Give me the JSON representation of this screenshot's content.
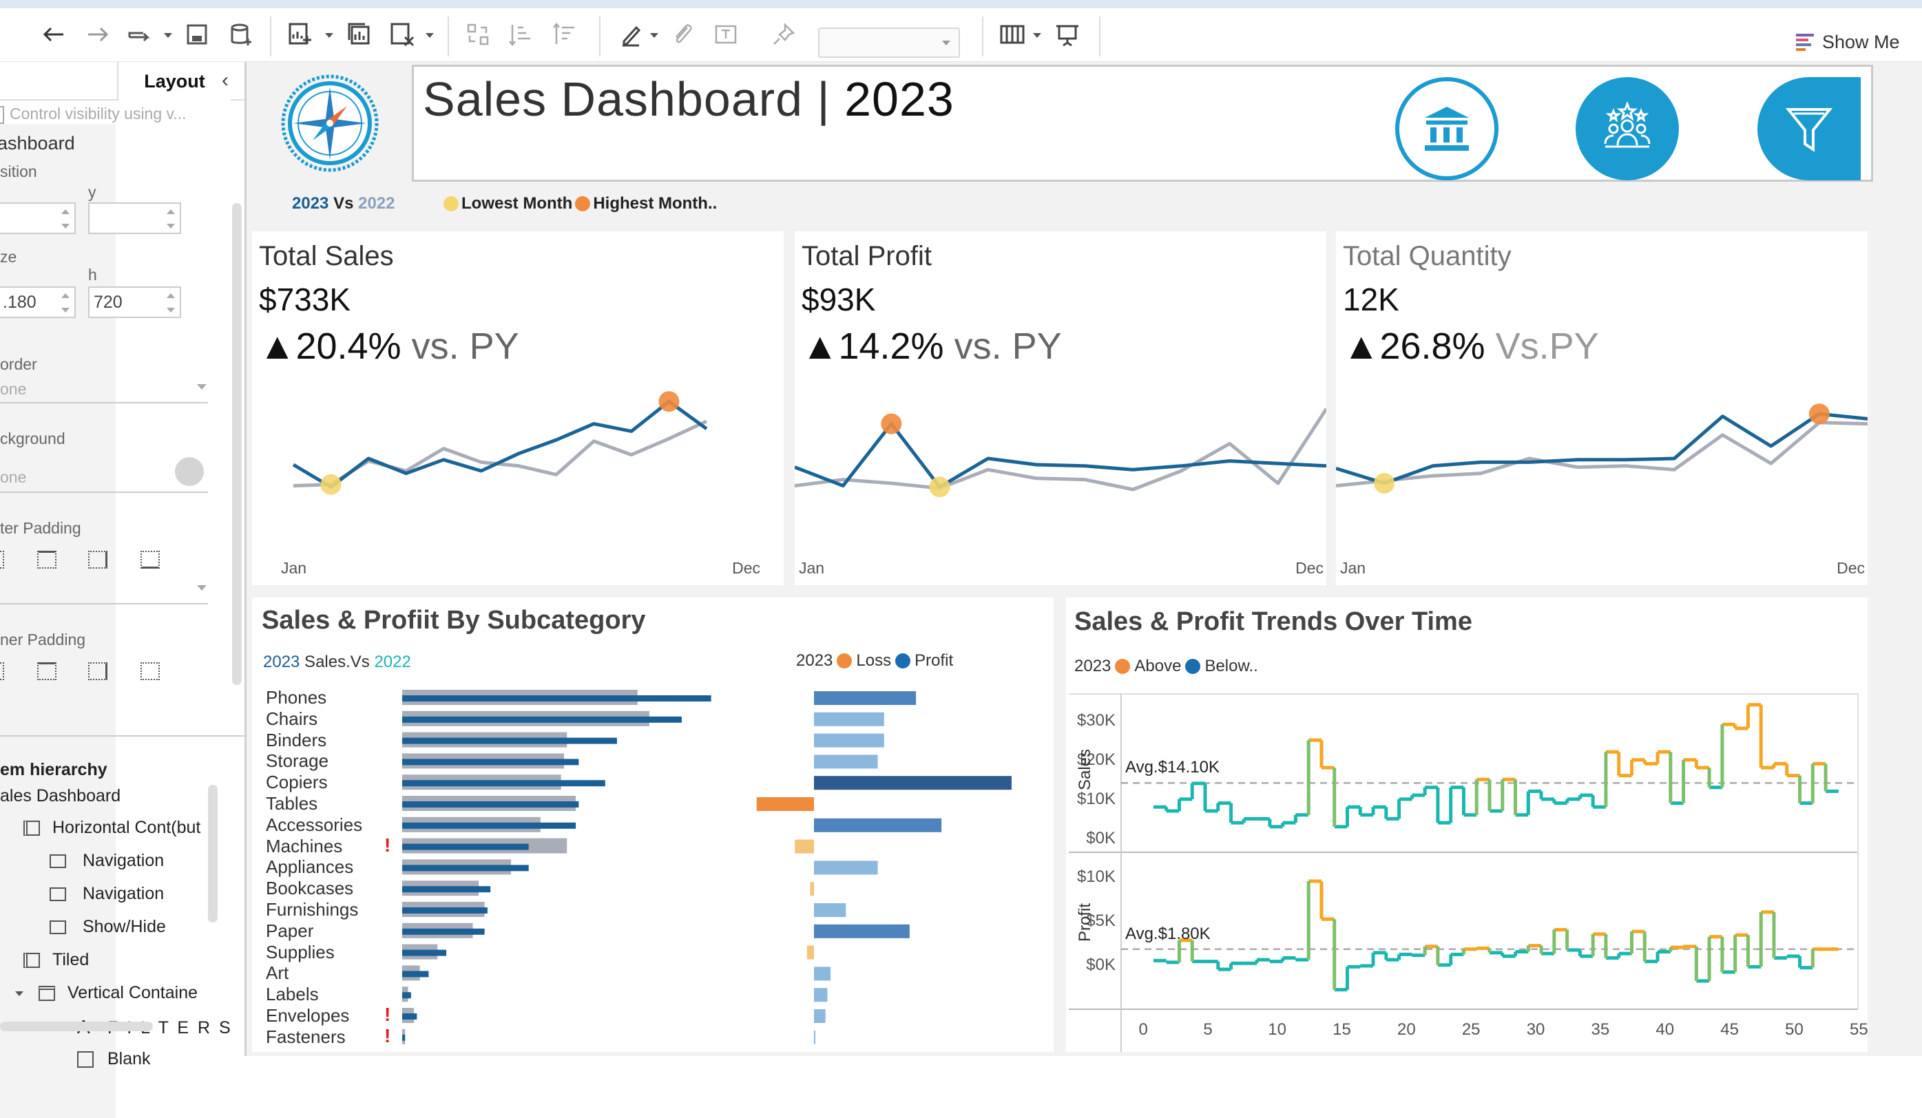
{
  "toolbar": {
    "show_me_label": "Show Me",
    "icons": [
      "undo-icon",
      "redo-icon",
      "replay-icon",
      "save-icon",
      "add-datasource-icon",
      "new-sheet-icon",
      "duplicate-sheet-icon",
      "clear-sheet-icon",
      "swap-icon",
      "sort-asc-icon",
      "sort-desc-icon",
      "highlight-icon",
      "attach-icon",
      "label-icon",
      "pin-icon",
      "fit-select",
      "show-cards-icon",
      "presentation-icon"
    ]
  },
  "left_pane": {
    "tab_dashboard": "ashboard",
    "tab_layout": "Layout",
    "control_visibility": "Control visibility using v...",
    "position_label": "sition",
    "y_label": "y",
    "size_label": "ze",
    "h_label": "h",
    "w_value": ".180",
    "h_value": "720",
    "border_label": "order",
    "border_value": "one",
    "background_label": "ckground",
    "background_value": "one",
    "outer_padding_label": "ter Padding",
    "inner_padding_label": "ner Padding",
    "hierarchy_title": "em hierarchy",
    "hierarchy_root": "ales Dashboard",
    "hierarchy_items": [
      {
        "label": "Horizontal Cont(but",
        "icon": "horizontal-container-icon"
      },
      {
        "label": "Navigation",
        "icon": "navigation-icon"
      },
      {
        "label": "Navigation",
        "icon": "navigation-icon"
      },
      {
        "label": "Show/Hide",
        "icon": "show-hide-icon"
      },
      {
        "label": "Tiled",
        "icon": "tiled-icon"
      },
      {
        "label": "Vertical Containe",
        "icon": "vertical-container-icon"
      },
      {
        "label": "F I L T E R S",
        "icon": "text-icon"
      },
      {
        "label": "Blank",
        "icon": "blank-icon"
      }
    ]
  },
  "header": {
    "title": "Sales Dashboard",
    "title_year": "2023",
    "legend_year_a": "2023",
    "legend_vs": "Vs",
    "legend_year_b": "2022",
    "lowest_label": "Lowest Month",
    "highest_label": "Highest Month..",
    "buttons": [
      "bank-icon",
      "customers-icon",
      "filter-icon"
    ]
  },
  "colors": {
    "cur": "#1a6496",
    "prev": "#a8adb8",
    "low": "#f3d66e",
    "high": "#f08a3c",
    "accent": "#1b9bd0",
    "loss": "#f08a3c",
    "profit": "#1a6eb0",
    "above": "#f5a623",
    "below": "#1bb6b0"
  },
  "kpis": [
    {
      "label": "Total Sales",
      "value": "$733K",
      "delta": "▲20.4%",
      "vs": " vs. PY",
      "x_start": "Jan",
      "x_end": "Dec",
      "cur": [
        45,
        27,
        50,
        38,
        49,
        40,
        54,
        65,
        78,
        72,
        96,
        74
      ],
      "prev": [
        28,
        29,
        48,
        40,
        58,
        47,
        44,
        37,
        64,
        53,
        66,
        80
      ],
      "low_idx": 1,
      "low_series": "prev",
      "high_idx": 10,
      "high_series": "cur"
    },
    {
      "label": "Total Profit",
      "value": "$93K",
      "delta": "▲14.2%",
      "vs": " vs. PY",
      "x_start": "Jan",
      "x_end": "Dec",
      "cur": [
        43,
        28,
        78,
        27,
        50,
        45,
        44,
        41,
        44,
        48,
        46,
        44
      ],
      "prev": [
        28,
        33,
        30,
        26,
        41,
        34,
        33,
        25,
        40,
        62,
        30,
        90
      ],
      "low_idx": 3,
      "low_series": "cur",
      "high_idx": 2,
      "high_series": "cur"
    },
    {
      "label": "Total Quantity",
      "value": "12K",
      "delta": "▲26.8%",
      "vs": " Vs.PY",
      "x_start": "Jan",
      "x_end": "Dec",
      "cur": [
        42,
        30,
        44,
        47,
        47,
        49,
        49,
        50,
        84,
        60,
        86,
        82
      ],
      "prev": [
        28,
        32,
        36,
        38,
        50,
        43,
        44,
        41,
        69,
        46,
        79,
        78
      ],
      "low_idx": 1,
      "low_series": "cur",
      "high_idx": 10,
      "high_series": "cur"
    }
  ],
  "subcategory": {
    "title": "Sales & Profiit By Subcategory",
    "legend_year_a": "2023",
    "legend_mid": " Sales.Vs ",
    "legend_year_b": "2022",
    "legend2_year": "2023",
    "loss_label": "Loss",
    "profit_label": "Profit"
  },
  "trends": {
    "title": "Sales & Profit Trends  Over Time",
    "legend_year": "2023",
    "above_label": "Above",
    "below_label": "Below..",
    "sales_axis": "Sales",
    "profit_axis": "Profit",
    "sales_ticks": [
      "$30K",
      "$20K",
      "$10K",
      "$0K"
    ],
    "profit_ticks": [
      "$10K",
      "$5K",
      "$0K"
    ],
    "sales_avg_label": "Avg.$14.10K",
    "profit_avg_label": "Avg.$1.80K",
    "x_ticks": [
      "0",
      "5",
      "10",
      "15",
      "20",
      "25",
      "30",
      "35",
      "40",
      "45",
      "50",
      "55"
    ]
  },
  "chart_data": [
    {
      "type": "bar",
      "title": "Sales & Profiit By Subcategory",
      "categories": [
        "Phones",
        "Chairs",
        "Binders",
        "Storage",
        "Copiers",
        "Tables",
        "Accessories",
        "Machines",
        "Appliances",
        "Bookcases",
        "Furnishings",
        "Paper",
        "Supplies",
        "Art",
        "Labels",
        "Envelopes",
        "Fasteners"
      ],
      "warnings": [
        false,
        false,
        false,
        false,
        false,
        false,
        false,
        true,
        false,
        false,
        false,
        false,
        false,
        false,
        false,
        true,
        true
      ],
      "series": [
        {
          "name": "2023",
          "values": [
            105,
            95,
            73,
            60,
            69,
            60,
            59,
            43,
            43,
            30,
            29,
            28,
            15,
            9,
            3,
            5,
            1
          ]
        },
        {
          "name": "2022",
          "values": [
            80,
            84,
            56,
            55,
            54,
            59,
            47,
            56,
            37,
            26,
            28,
            24,
            12,
            6,
            2,
            4,
            1
          ]
        },
        {
          "name": "Profit",
          "values": [
            16,
            11,
            11,
            10,
            31,
            -9,
            20,
            -3,
            10,
            -0.6,
            5,
            15,
            -1.1,
            2.6,
            2.1,
            1.8,
            0.1
          ]
        }
      ],
      "xlim_sales": [
        0,
        110
      ],
      "xlim_profit": [
        -15,
        35
      ]
    },
    {
      "type": "line",
      "title": "Sales & Profit Trends  Over Time",
      "x": [
        1,
        2,
        3,
        4,
        5,
        6,
        7,
        8,
        9,
        10,
        11,
        12,
        13,
        14,
        15,
        16,
        17,
        18,
        19,
        20,
        21,
        22,
        23,
        24,
        25,
        26,
        27,
        28,
        29,
        30,
        31,
        32,
        33,
        34,
        35,
        36,
        37,
        38,
        39,
        40,
        41,
        42,
        43,
        44,
        45,
        46,
        47,
        48,
        49,
        50,
        51,
        52,
        53
      ],
      "series": [
        {
          "name": "Sales",
          "values": [
            8,
            7,
            10,
            14,
            7,
            9,
            4,
            5,
            5,
            3,
            4,
            6,
            25,
            18,
            3,
            8,
            6,
            8,
            5,
            10,
            11,
            13,
            4,
            13,
            6,
            15,
            7,
            15,
            6,
            12,
            10,
            9,
            10,
            11,
            8,
            22,
            16,
            20,
            19,
            22,
            9,
            20,
            18,
            13,
            29,
            28,
            34,
            18,
            19,
            16,
            9,
            19,
            12
          ],
          "avg": 14.1,
          "ylim": [
            0,
            35
          ]
        },
        {
          "name": "Profit",
          "values": [
            0.5,
            0.3,
            2.8,
            0.4,
            0.4,
            -0.5,
            0.2,
            0.2,
            0.6,
            0.4,
            0.8,
            0.6,
            9.5,
            5.2,
            -2.8,
            -0.2,
            -0.1,
            1.4,
            0.6,
            1.2,
            1.1,
            2.1,
            0,
            1.2,
            1.8,
            1.9,
            1.4,
            1.0,
            1.5,
            2.2,
            1.3,
            4.0,
            1.7,
            1.0,
            3.5,
            0.8,
            1.3,
            3.8,
            0.4,
            1.5,
            2.0,
            2.1,
            -1.8,
            3.2,
            -0.8,
            3.4,
            -0.2,
            6.0,
            0.8,
            1.0,
            -0.3,
            1.8,
            1.8
          ],
          "avg": 1.8,
          "ylim": [
            -4,
            12
          ]
        }
      ],
      "xlim": [
        -2,
        55
      ]
    }
  ]
}
